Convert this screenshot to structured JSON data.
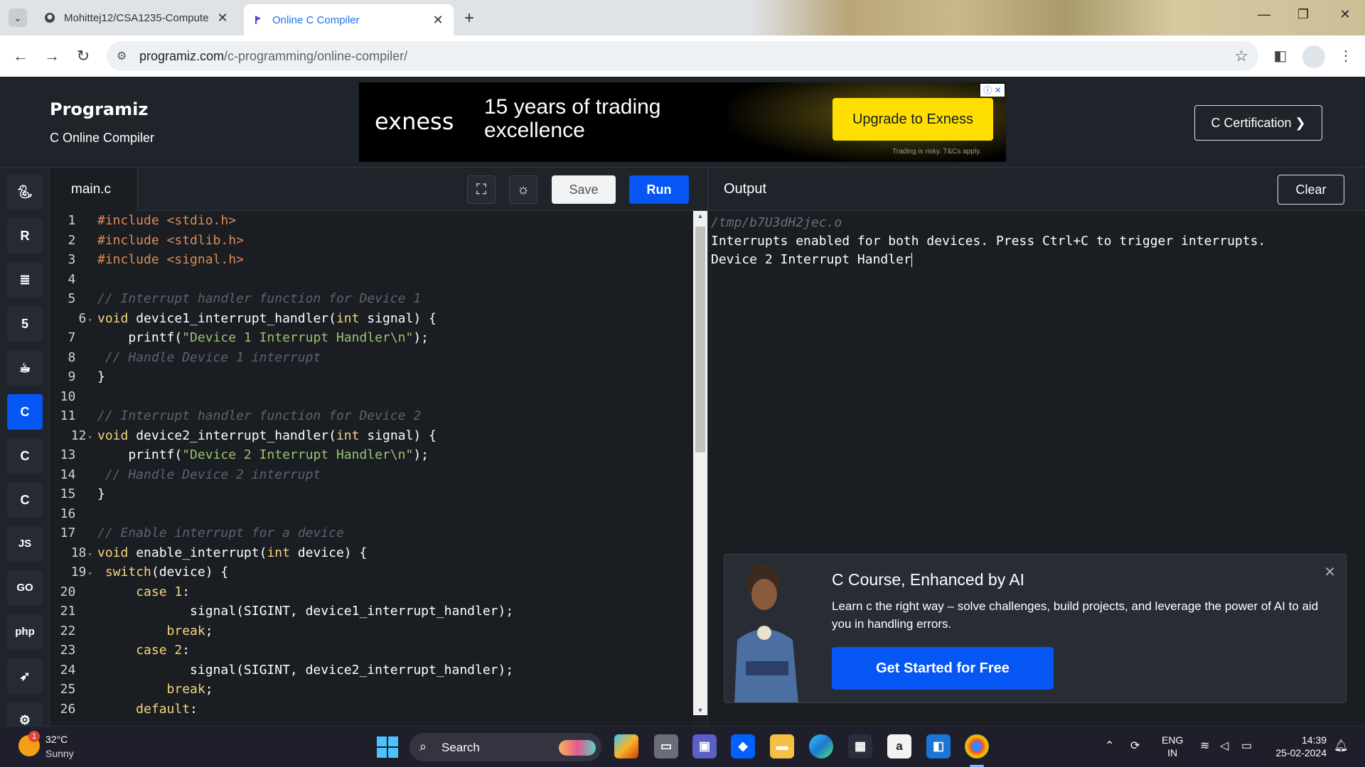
{
  "browser": {
    "tabs": [
      {
        "title": "Mohittej12/CSA1235-Compute",
        "favicon": "github-icon",
        "active": false
      },
      {
        "title": "Online C Compiler",
        "favicon": "programiz-icon",
        "active": true
      }
    ],
    "url_host": "programiz.com",
    "url_path": "/c-programming/online-compiler/"
  },
  "header": {
    "logo": "Programiz",
    "subtitle": "C Online Compiler",
    "certification_button": "C Certification ❯"
  },
  "ad": {
    "brand": "exness",
    "tagline": "15 years of trading excellence",
    "cta": "Upgrade to Exness",
    "disclaimer": "Trading is risky. T&Cs apply."
  },
  "languages": [
    "python",
    "r",
    "sql",
    "html",
    "java",
    "c",
    "cpp",
    "csharp",
    "JS",
    "GO",
    "php",
    "swift",
    "rust"
  ],
  "active_language": "c",
  "editor": {
    "filename": "main.c",
    "save_label": "Save",
    "run_label": "Run",
    "code": [
      [
        [
          "pp",
          "#include <stdio.h>"
        ]
      ],
      [
        [
          "pp",
          "#include <stdlib.h>"
        ]
      ],
      [
        [
          "pp",
          "#include <signal.h>"
        ]
      ],
      [],
      [
        [
          "cm",
          "// Interrupt handler function for Device 1"
        ]
      ],
      [
        [
          "kw",
          "void"
        ],
        [
          "tx",
          " device1_interrupt_handler("
        ],
        [
          "kw",
          "int"
        ],
        [
          "tx",
          " signal) {"
        ]
      ],
      [
        [
          "tx",
          "    printf("
        ],
        [
          "st",
          "\"Device 1 Interrupt Handler\\n\""
        ],
        [
          "tx",
          ");"
        ]
      ],
      [
        [
          "cm",
          " // Handle Device 1 interrupt"
        ]
      ],
      [
        [
          "tx",
          "}"
        ]
      ],
      [],
      [
        [
          "cm",
          "// Interrupt handler function for Device 2"
        ]
      ],
      [
        [
          "kw",
          "void"
        ],
        [
          "tx",
          " device2_interrupt_handler("
        ],
        [
          "kw",
          "int"
        ],
        [
          "tx",
          " signal) {"
        ]
      ],
      [
        [
          "tx",
          "    printf("
        ],
        [
          "st",
          "\"Device 2 Interrupt Handler\\n\""
        ],
        [
          "tx",
          ");"
        ]
      ],
      [
        [
          "cm",
          " // Handle Device 2 interrupt"
        ]
      ],
      [
        [
          "tx",
          "}"
        ]
      ],
      [],
      [
        [
          "cm",
          "// Enable interrupt for a device"
        ]
      ],
      [
        [
          "kw",
          "void"
        ],
        [
          "tx",
          " enable_interrupt("
        ],
        [
          "kw",
          "int"
        ],
        [
          "tx",
          " device) {"
        ]
      ],
      [
        [
          "kw",
          " switch"
        ],
        [
          "tx",
          "(device) {"
        ]
      ],
      [
        [
          "kw",
          "     case"
        ],
        [
          "tx",
          " "
        ],
        [
          "kw",
          "1"
        ],
        [
          "tx",
          ":"
        ]
      ],
      [
        [
          "tx",
          "            signal(SIGINT, device1_interrupt_handler);"
        ]
      ],
      [
        [
          "kw",
          "         break"
        ],
        [
          "tx",
          ";"
        ]
      ],
      [
        [
          "kw",
          "     case"
        ],
        [
          "tx",
          " "
        ],
        [
          "kw",
          "2"
        ],
        [
          "tx",
          ":"
        ]
      ],
      [
        [
          "tx",
          "            signal(SIGINT, device2_interrupt_handler);"
        ]
      ],
      [
        [
          "kw",
          "         break"
        ],
        [
          "tx",
          ";"
        ]
      ],
      [
        [
          "kw",
          "     default"
        ],
        [
          "tx",
          ":"
        ]
      ]
    ],
    "fold_lines": [
      6,
      12,
      18,
      19
    ]
  },
  "output": {
    "title": "Output",
    "clear_label": "Clear",
    "path_line": "/tmp/b7U3dH2jec.o",
    "lines": [
      "Interrupts enabled for both devices. Press Ctrl+C to trigger interrupts.",
      "Device 2 Interrupt Handler"
    ]
  },
  "promo": {
    "title": "C Course, Enhanced by AI",
    "description": "Learn c the right way – solve challenges, build projects, and leverage the power of AI to aid you in handling errors.",
    "button": "Get Started for Free"
  },
  "taskbar": {
    "temperature": "32°C",
    "weather": "Sunny",
    "weather_badge": "1",
    "search_label": "Search",
    "language": "ENG",
    "region": "IN",
    "time": "14:39",
    "date": "25-02-2024"
  }
}
